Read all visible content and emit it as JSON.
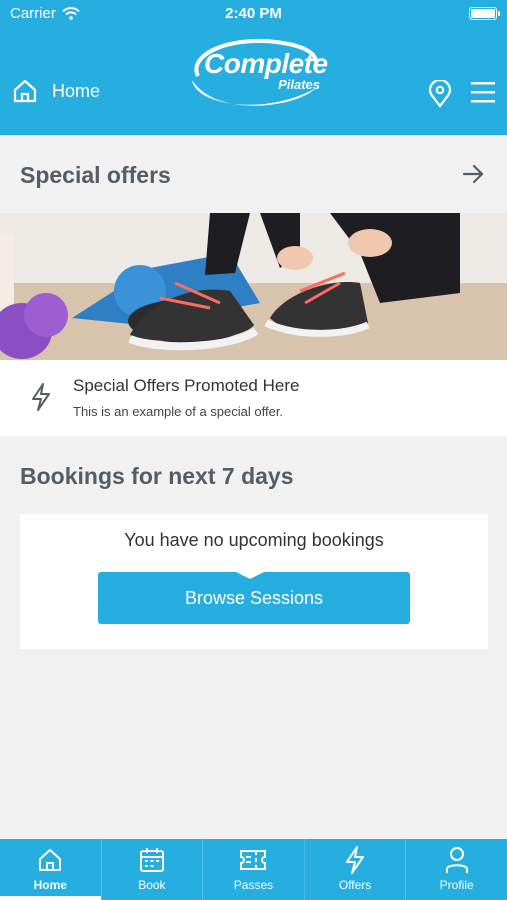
{
  "status_bar": {
    "carrier": "Carrier",
    "time": "2:40 PM"
  },
  "header": {
    "home_label": "Home",
    "logo_text": "Complete",
    "logo_subtext": "Pilates"
  },
  "special_offers": {
    "title": "Special offers",
    "offer_title": "Special Offers Promoted Here",
    "offer_description": "This is an example of a special offer."
  },
  "bookings": {
    "title": "Bookings for next 7 days",
    "empty_message": "You have no upcoming bookings",
    "browse_label": "Browse Sessions"
  },
  "tabbar": {
    "items": [
      {
        "label": "Home",
        "icon": "home-icon",
        "active": true
      },
      {
        "label": "Book",
        "icon": "calendar-icon",
        "active": false
      },
      {
        "label": "Passes",
        "icon": "ticket-icon",
        "active": false
      },
      {
        "label": "Offers",
        "icon": "lightning-icon",
        "active": false
      },
      {
        "label": "Profile",
        "icon": "person-icon",
        "active": false
      }
    ]
  },
  "colors": {
    "brand": "#27aee0",
    "background": "#f1f1f2",
    "heading": "#555d63"
  }
}
